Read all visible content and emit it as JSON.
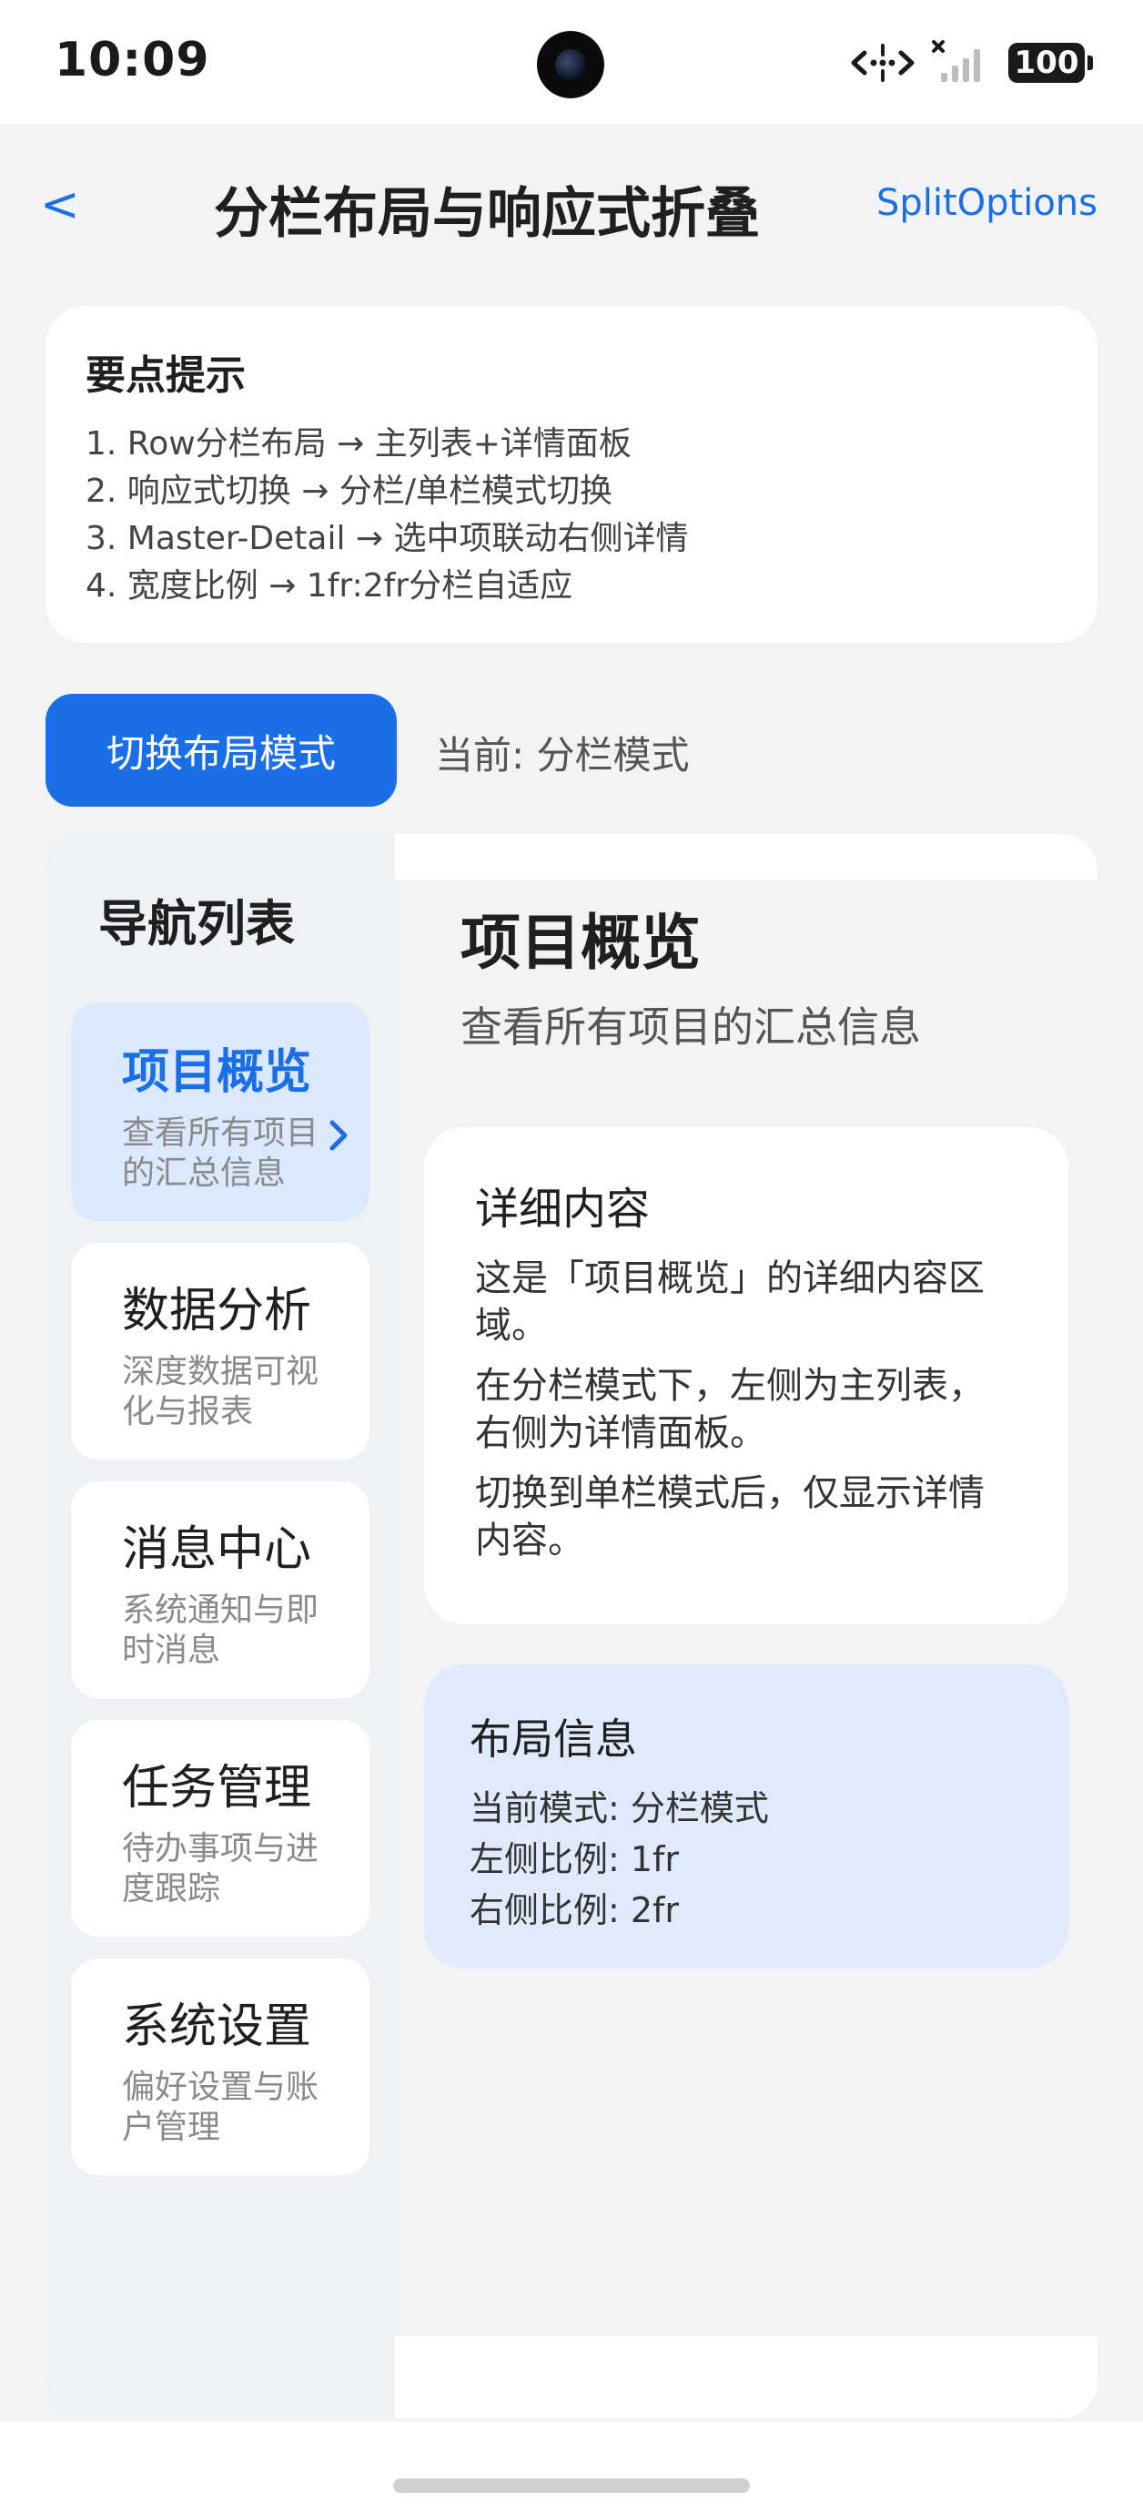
{
  "status_bar": {
    "time": "10:09",
    "battery": "100",
    "icons": [
      "network-data-icon",
      "signal-icon",
      "battery-icon"
    ]
  },
  "header": {
    "back_label": "<",
    "title": "分栏布局与响应式折叠",
    "action_label": "SplitOptions"
  },
  "tips": {
    "title": "要点提示",
    "items": [
      "1. Row分栏布局 → 主列表+详情面板",
      "2. 响应式切换 → 分栏/单栏模式切换",
      "3. Master-Detail → 选中项联动右侧详情",
      "4. 宽度比例 → 1fr:2fr分栏自适应"
    ]
  },
  "toolbar": {
    "toggle_label": "切换布局模式",
    "mode_label": "当前: 分栏模式"
  },
  "nav": {
    "title": "导航列表",
    "items": [
      {
        "title": "项目概览",
        "desc": "查看所有项目的汇总信息",
        "active": true
      },
      {
        "title": "数据分析",
        "desc": "深度数据可视化与报表",
        "active": false
      },
      {
        "title": "消息中心",
        "desc": "系统通知与即时消息",
        "active": false
      },
      {
        "title": "任务管理",
        "desc": "待办事项与进度跟踪",
        "active": false
      },
      {
        "title": "系统设置",
        "desc": "偏好设置与账户管理",
        "active": false
      }
    ]
  },
  "detail": {
    "title": "项目概览",
    "subtitle": "查看所有项目的汇总信息",
    "content_card": {
      "title": "详细内容",
      "paragraphs": [
        "这是「项目概览」的详细内容区域。",
        "在分栏模式下，左侧为主列表，右侧为详情面板。",
        "切换到单栏模式后，仅显示详情内容。"
      ]
    },
    "info_card": {
      "title": "布局信息",
      "lines": [
        "当前模式: 分栏模式",
        "左侧比例: 1fr",
        "右侧比例: 2fr"
      ]
    }
  },
  "colors": {
    "accent": "#1a6fe8",
    "active_item_bg": "#dbe9fe",
    "info_card_bg": "#dfeafd",
    "page_bg": "#f1f3f5"
  }
}
